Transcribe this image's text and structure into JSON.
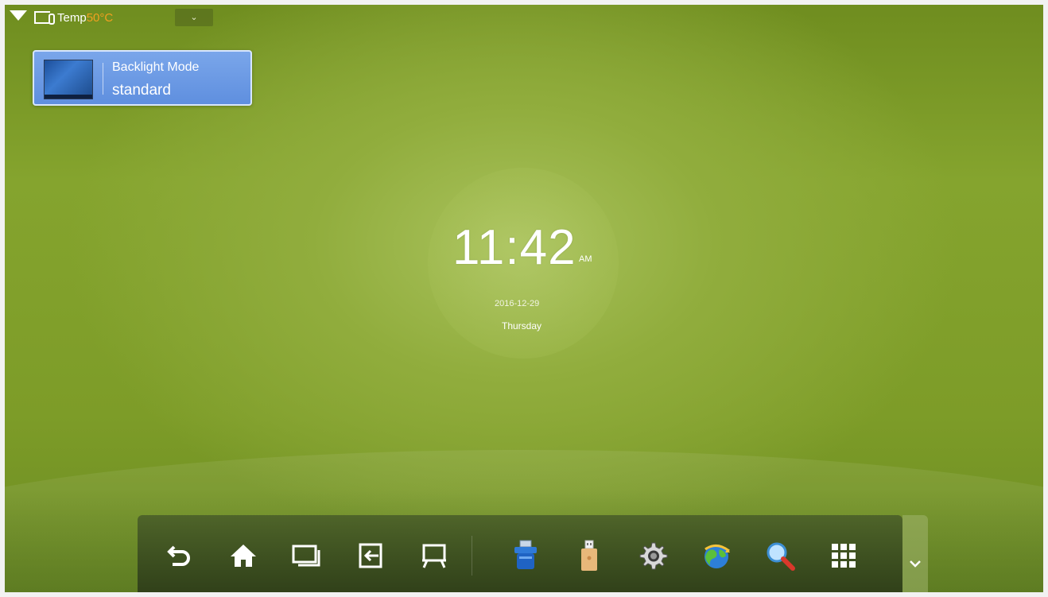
{
  "status_bar": {
    "temp_label": "Temp",
    "temp_value": "50°C",
    "dropdown_glyph": "⌄",
    "icons": [
      "wifi-icon",
      "temperature-icon"
    ],
    "colors": {
      "temp_value": "#f0a020"
    }
  },
  "backlight": {
    "title": "Backlight Mode",
    "value": "standard",
    "colors": {
      "card": "#6b98e4"
    }
  },
  "clock": {
    "time": "11:42",
    "ampm": "AM",
    "date": "2016-12-29",
    "day": "Thursday"
  },
  "dock": {
    "nav_buttons": [
      "back-icon",
      "home-icon",
      "recent-apps-icon",
      "input-source-icon",
      "whiteboard-icon"
    ],
    "app_buttons": [
      "usb-drive-icon",
      "usb-stick-icon",
      "settings-gear-icon",
      "browser-globe-icon",
      "search-icon",
      "app-grid-icon"
    ],
    "expand_icon": "chevron-down-icon"
  },
  "colors": {
    "background_green": "#85a42e",
    "dock": "#3f5424"
  }
}
